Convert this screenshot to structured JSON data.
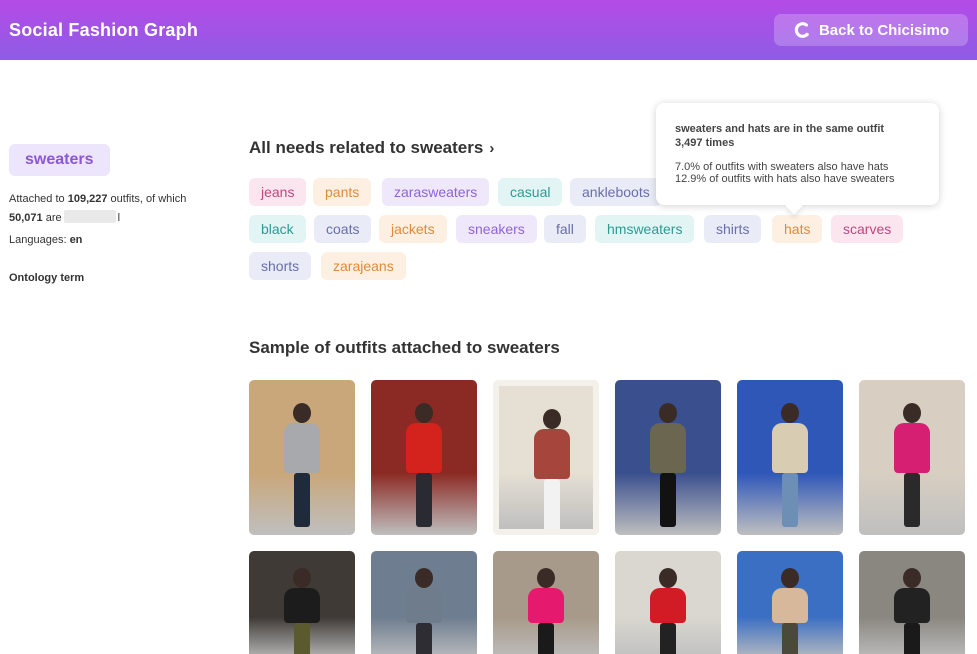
{
  "header": {
    "title": "Social Fashion Graph",
    "back_label": "Back to Chicisimo"
  },
  "topic": {
    "name": "sweaters",
    "attached_prefix": "Attached to",
    "outfits_count": "109,227",
    "attached_suffix": "outfits, of which",
    "sub_count": "50,071",
    "sub_suffix_start": "are",
    "sub_suffix_end": "l",
    "languages_label": "Languages:",
    "languages_value": "en",
    "ontology_label": "Ontology term"
  },
  "needs": {
    "title": "All needs related to sweaters",
    "tags": [
      {
        "label": "jeans",
        "bg": "#fbe6ef",
        "fg": "#c2457e"
      },
      {
        "label": "pants",
        "bg": "#fdf0e3",
        "fg": "#e08a3a"
      },
      {
        "label": "zarasweaters",
        "bg": "#efe8fb",
        "fg": "#8f63d6"
      },
      {
        "label": "casual",
        "bg": "#e2f4f3",
        "fg": "#2f9a95"
      },
      {
        "label": "ankleboots",
        "bg": "#e9ebf6",
        "fg": "#6a6fa8"
      },
      {
        "label": "black",
        "bg": "#e2f4f3",
        "fg": "#2f9a95"
      },
      {
        "label": "coats",
        "bg": "#e9ebf6",
        "fg": "#6a6fa8"
      },
      {
        "label": "jackets",
        "bg": "#fdf0e3",
        "fg": "#e08a3a"
      },
      {
        "label": "sneakers",
        "bg": "#efe8fb",
        "fg": "#8f63d6"
      },
      {
        "label": "fall",
        "bg": "#e9ebf6",
        "fg": "#6a6fa8"
      },
      {
        "label": "hmsweaters",
        "bg": "#e2f4f3",
        "fg": "#2f9a95"
      },
      {
        "label": "shirts",
        "bg": "#e9ebf6",
        "fg": "#6a6fa8"
      },
      {
        "label": "hats",
        "bg": "#fdf0e3",
        "fg": "#e08a3a"
      },
      {
        "label": "scarves",
        "bg": "#fbe6ef",
        "fg": "#c2457e"
      },
      {
        "label": "shorts",
        "bg": "#e9ebf6",
        "fg": "#6a6fa8"
      },
      {
        "label": "zarajeans",
        "bg": "#fdf0e3",
        "fg": "#e08a3a"
      }
    ]
  },
  "tooltip": {
    "line1": "sweaters and hats are in the same outfit",
    "line2": "3,497 times",
    "stat1": "7.0% of outfits with sweaters also have hats",
    "stat2": "12.9% of outfits with hats also have sweaters"
  },
  "samples": {
    "title": "Sample of outfits attached to sweaters",
    "outfits": [
      {
        "bg": "#c9a77a",
        "top": "#a7a9ad",
        "legs": "#1f2a3a"
      },
      {
        "bg": "#8b2a24",
        "top": "#d4221d",
        "legs": "#2a2a33"
      },
      {
        "bg": "#e6e0d4",
        "top": "#a5453c",
        "legs": "#f2f2f2"
      },
      {
        "bg": "#3a4f8e",
        "top": "#6b6650",
        "legs": "#121212"
      },
      {
        "bg": "#2f57b8",
        "top": "#d8ccb2",
        "legs": "#6d8fb6"
      },
      {
        "bg": "#d8cfc2",
        "top": "#d61e72",
        "legs": "#2a2a2a"
      },
      {
        "bg": "#3f3a36",
        "top": "#1c1c1c",
        "legs": "#5b5a2f"
      },
      {
        "bg": "#6e7d8f",
        "top": "#6f7c8c",
        "legs": "#2d2d33"
      },
      {
        "bg": "#a89a8a",
        "top": "#e5196e",
        "legs": "#1a1a1a"
      },
      {
        "bg": "#d9d7cf",
        "top": "#d11c25",
        "legs": "#222"
      },
      {
        "bg": "#3b6fc3",
        "top": "#d8b89a",
        "legs": "#4a4a3a"
      },
      {
        "bg": "#8a8780",
        "top": "#222222",
        "legs": "#1a1a1a"
      }
    ]
  }
}
